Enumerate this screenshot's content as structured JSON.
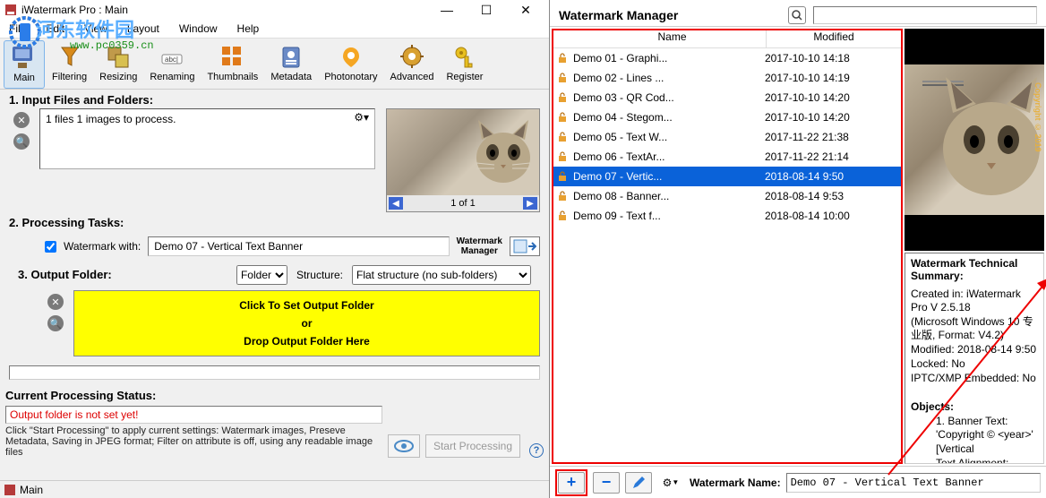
{
  "window": {
    "title": "iWatermark Pro : Main"
  },
  "overlay": {
    "site_name": "河东软件园",
    "site_url": "www.pc0359.cn"
  },
  "menu": [
    "File",
    "Edit",
    "View",
    "Layout",
    "Window",
    "Help"
  ],
  "toolbar": [
    {
      "label": "Main",
      "sel": true
    },
    {
      "label": "Filtering"
    },
    {
      "label": "Resizing"
    },
    {
      "label": "Renaming"
    },
    {
      "label": "Thumbnails"
    },
    {
      "label": "Metadata"
    },
    {
      "label": "Photonotary"
    },
    {
      "label": "Advanced"
    },
    {
      "label": "Register"
    }
  ],
  "sections": {
    "input_h": "1. Input Files and Folders:",
    "input_text": "1 files 1 images to process.",
    "preview_nav": "1 of 1",
    "tasks_h": "2. Processing Tasks:",
    "wm_with": "Watermark with:",
    "wm_selected": "Demo 07 - Vertical Text Banner",
    "wm_mgr_l1": "Watermark",
    "wm_mgr_l2": "Manager",
    "output_h": "3. Output Folder:",
    "folder_label": "Folder",
    "structure_label": "Structure:",
    "structure_sel": "Flat structure (no sub-folders)",
    "yellow_l1": "Click  To Set Output Folder",
    "yellow_l2": "or",
    "yellow_l3": "Drop Output Folder Here",
    "status_h": "Current Processing Status:",
    "status_err": "Output folder is not set yet!",
    "status_desc": "Click \"Start Processing\" to apply current settings: Watermark images, Preseve Metadata, Saving in JPEG format; Filter on attribute is off, using any readable image files",
    "start_btn": "Start Processing",
    "statusbar": "Main"
  },
  "right": {
    "title": "Watermark Manager",
    "col_name": "Name",
    "col_mod": "Modified",
    "rows": [
      {
        "name": "Demo 01 - Graphi...",
        "mod": "2017-10-10 14:18"
      },
      {
        "name": "Demo 02 - Lines ...",
        "mod": "2017-10-10 14:19"
      },
      {
        "name": "Demo 03 - QR Cod...",
        "mod": "2017-10-10 14:20"
      },
      {
        "name": "Demo 04 - Stegom...",
        "mod": "2017-10-10 14:20"
      },
      {
        "name": "Demo 05 - Text W...",
        "mod": "2017-11-22 21:38"
      },
      {
        "name": "Demo 06 - TextAr...",
        "mod": "2017-11-22 21:14"
      },
      {
        "name": "Demo 07 - Vertic...",
        "mod": "2018-08-14 9:50",
        "sel": true
      },
      {
        "name": "Demo 08 - Banner...",
        "mod": "2018-08-14 9:53"
      },
      {
        "name": "Demo 09 - Text f...",
        "mod": "2018-08-14 10:00"
      }
    ],
    "preview_vtext": "Copyright © 2019",
    "summary": {
      "h": "Watermark Technical Summary:",
      "l1": "Created in: iWatermark Pro V 2.5.18",
      "l2": "(Microsoft Windows 10 专业版, Format: V4.2)",
      "l3": "Modified: 2018-08-14 9:50",
      "l4": "Locked: No",
      "l5": "IPTC/XMP Embedded: No",
      "l6": "Objects:",
      "l7": "1. Banner Text: 'Copyright © <year>'",
      "l8": "[Vertical",
      "l9": "Text Alignment: Center"
    },
    "foot_label": "Watermark Name:",
    "foot_value": "Demo 07 - Vertical Text Banner"
  }
}
